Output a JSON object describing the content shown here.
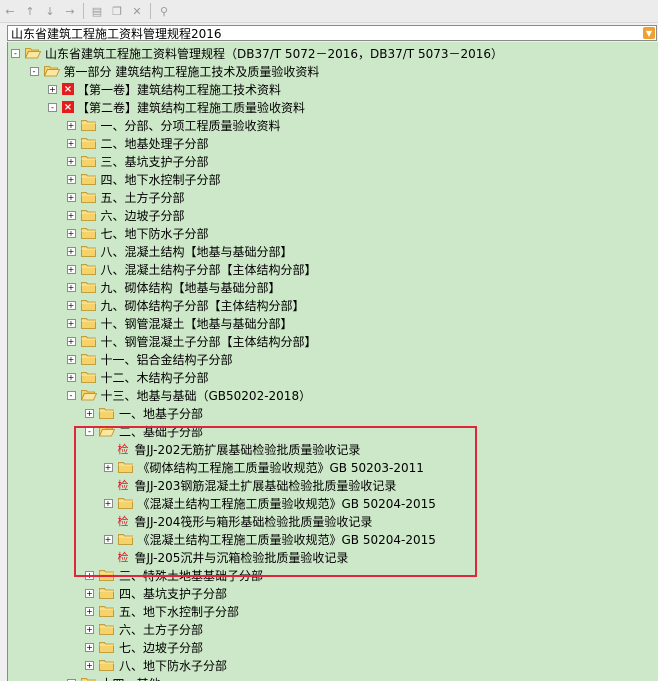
{
  "toolbar": {
    "icons": [
      "back-arrow-icon",
      "up-arrow-icon",
      "down-arrow-icon",
      "forward-arrow-icon",
      "new-doc-icon",
      "copy-icon",
      "delete-icon",
      "filter-icon"
    ]
  },
  "combo": {
    "value": "山东省建筑工程施工资料管理规程2016"
  },
  "tree": {
    "items": [
      {
        "level": 0,
        "exp": "-",
        "icon": "folder-open",
        "label": "山东省建筑工程施工资料管理规程（DB37/T 5072－2016，DB37/T 5073－2016）"
      },
      {
        "level": 1,
        "exp": "-",
        "icon": "folder-open",
        "label": "第一部分  建筑结构工程施工技术及质量验收资料"
      },
      {
        "level": 2,
        "exp": "+",
        "icon": "red-x",
        "label": "【第一卷】建筑结构工程施工技术资料"
      },
      {
        "level": 2,
        "exp": "-",
        "icon": "red-x",
        "label": "【第二卷】建筑结构工程施工质量验收资料"
      },
      {
        "level": 3,
        "exp": "+",
        "icon": "folder",
        "label": "一、分部、分项工程质量验收资料"
      },
      {
        "level": 3,
        "exp": "+",
        "icon": "folder",
        "label": "二、地基处理子分部"
      },
      {
        "level": 3,
        "exp": "+",
        "icon": "folder",
        "label": "三、基坑支护子分部"
      },
      {
        "level": 3,
        "exp": "+",
        "icon": "folder",
        "label": "四、地下水控制子分部"
      },
      {
        "level": 3,
        "exp": "+",
        "icon": "folder",
        "label": "五、土方子分部"
      },
      {
        "level": 3,
        "exp": "+",
        "icon": "folder",
        "label": "六、边坡子分部"
      },
      {
        "level": 3,
        "exp": "+",
        "icon": "folder",
        "label": "七、地下防水子分部"
      },
      {
        "level": 3,
        "exp": "+",
        "icon": "folder",
        "label": "八、混凝土结构【地基与基础分部】"
      },
      {
        "level": 3,
        "exp": "+",
        "icon": "folder",
        "label": "八、混凝土结构子分部【主体结构分部】"
      },
      {
        "level": 3,
        "exp": "+",
        "icon": "folder",
        "label": "九、砌体结构【地基与基础分部】"
      },
      {
        "level": 3,
        "exp": "+",
        "icon": "folder",
        "label": "九、砌体结构子分部【主体结构分部】"
      },
      {
        "level": 3,
        "exp": "+",
        "icon": "folder",
        "label": "十、钢管混凝土【地基与基础分部】"
      },
      {
        "level": 3,
        "exp": "+",
        "icon": "folder",
        "label": "十、钢管混凝土子分部【主体结构分部】"
      },
      {
        "level": 3,
        "exp": "+",
        "icon": "folder",
        "label": "十一、铝合金结构子分部"
      },
      {
        "level": 3,
        "exp": "+",
        "icon": "folder",
        "label": "十二、木结构子分部"
      },
      {
        "level": 3,
        "exp": "-",
        "icon": "folder-open",
        "label": "十三、地基与基础（GB50202-2018）"
      },
      {
        "level": 4,
        "exp": "+",
        "icon": "folder",
        "label": "一、地基子分部"
      },
      {
        "level": 4,
        "exp": "-",
        "icon": "folder-open",
        "label": "二、基础子分部"
      },
      {
        "level": 5,
        "exp": "",
        "icon": "jian",
        "label": "鲁JJ-202无筋扩展基础检验批质量验收记录"
      },
      {
        "level": 5,
        "exp": "+",
        "icon": "folder",
        "label": "《砌体结构工程施工质量验收规范》GB 50203-2011"
      },
      {
        "level": 5,
        "exp": "",
        "icon": "jian",
        "label": "鲁JJ-203钢筋混凝土扩展基础检验批质量验收记录"
      },
      {
        "level": 5,
        "exp": "+",
        "icon": "folder",
        "label": "《混凝土结构工程施工质量验收规范》GB 50204-2015"
      },
      {
        "level": 5,
        "exp": "",
        "icon": "jian",
        "label": "鲁JJ-204筏形与箱形基础检验批质量验收记录"
      },
      {
        "level": 5,
        "exp": "+",
        "icon": "folder",
        "label": "《混凝土结构工程施工质量验收规范》GB 50204-2015"
      },
      {
        "level": 5,
        "exp": "",
        "icon": "jian",
        "label": "鲁JJ-205沉井与沉箱检验批质量验收记录"
      },
      {
        "level": 4,
        "exp": "+",
        "icon": "folder",
        "label": "三、特殊土地基基础子分部"
      },
      {
        "level": 4,
        "exp": "+",
        "icon": "folder",
        "label": "四、基坑支护子分部"
      },
      {
        "level": 4,
        "exp": "+",
        "icon": "folder",
        "label": "五、地下水控制子分部"
      },
      {
        "level": 4,
        "exp": "+",
        "icon": "folder",
        "label": "六、土方子分部"
      },
      {
        "level": 4,
        "exp": "+",
        "icon": "folder",
        "label": "七、边坡子分部"
      },
      {
        "level": 4,
        "exp": "+",
        "icon": "folder",
        "label": "八、地下防水子分部"
      },
      {
        "level": 3,
        "exp": "+",
        "icon": "folder",
        "label": "十四、其他"
      }
    ],
    "jian_glyph": "检",
    "redx_glyph": "×",
    "highlight_color": "#e0263c"
  }
}
